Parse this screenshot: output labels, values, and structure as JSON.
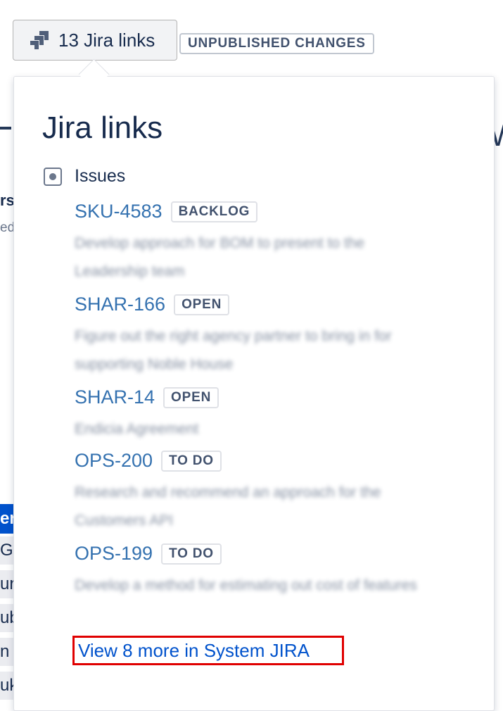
{
  "header": {
    "jira_button_label": "13 Jira links",
    "jira_button_icon": "jira-icon",
    "unpublished_badge": "UNPUBLISHED CHANGES"
  },
  "background": {
    "list_fragments": [
      "er",
      "G",
      "ur",
      "ub",
      "n",
      "uk"
    ],
    "frag_rs": "rs",
    "frag_ed": "ed"
  },
  "popup": {
    "title": "Jira links",
    "group": {
      "label": "Issues",
      "icon": "issue-type-icon"
    },
    "issues": [
      {
        "key": "SKU-4583",
        "status": "BACKLOG",
        "summary": "Develop approach for BOM to present to the Leadership team"
      },
      {
        "key": "SHAR-166",
        "status": "OPEN",
        "summary": "Figure out the right agency partner to bring in for supporting Noble House"
      },
      {
        "key": "SHAR-14",
        "status": "OPEN",
        "summary": "Endicia Agreement"
      },
      {
        "key": "OPS-200",
        "status": "TO DO",
        "summary": "Research and recommend an approach for the Customers API"
      },
      {
        "key": "OPS-199",
        "status": "TO DO",
        "summary": "Develop a method for estimating out cost of features"
      }
    ],
    "more_link": "View 8 more in System JIRA"
  },
  "colors": {
    "link": "#3572b0",
    "more_link": "#0052cc",
    "highlight_box": "#e00000",
    "selected_item": "#0052cc"
  }
}
